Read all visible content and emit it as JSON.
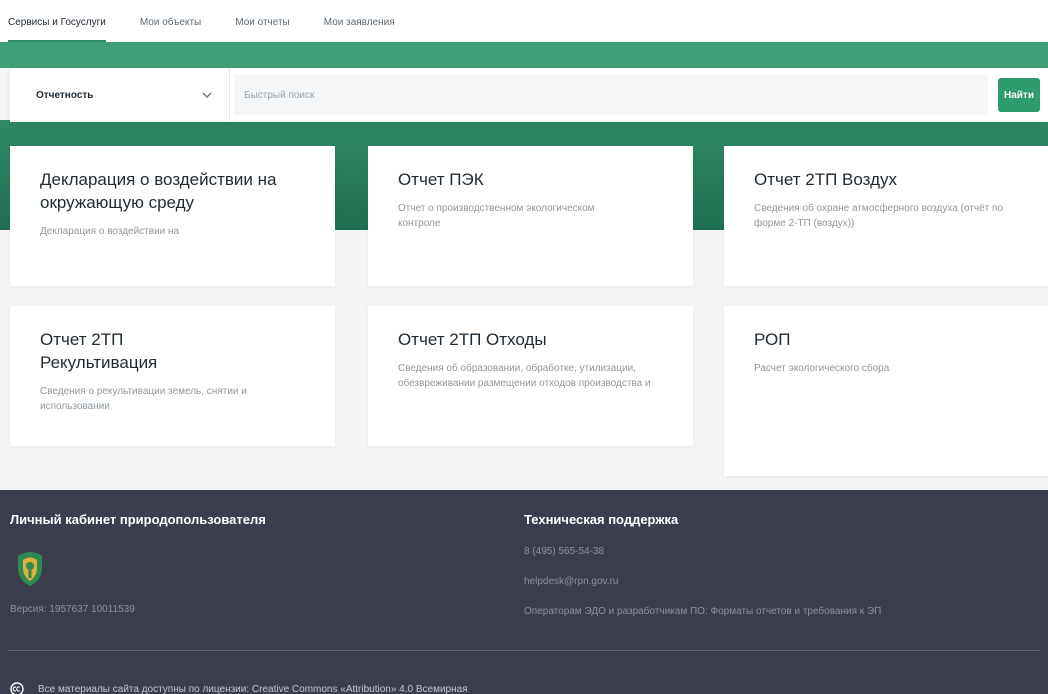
{
  "tabs": [
    {
      "label": "Сервисы и Госуслуги"
    },
    {
      "label": "Мои объекты"
    },
    {
      "label": "Мои отчеты"
    },
    {
      "label": "Мои заявления"
    }
  ],
  "search": {
    "category_value": "Отчетность",
    "placeholder": "Быстрый поиск",
    "button_label": "Найти"
  },
  "cards": [
    {
      "title": "Декларация о воздействии на окружающую среду",
      "description": "Декларация о воздействии на"
    },
    {
      "title": "Отчет ПЭК",
      "description": "Отчет о производственном экологическом контроле"
    },
    {
      "title": "Отчет 2ТП Воздух",
      "description": "Сведения об охране атмосферного воздуха (отчёт по форме 2-ТП (воздух))"
    },
    {
      "title": "Отчет 2ТП Рекультивация",
      "description": "Сведения о рекультивации земель, снятии и использовании"
    },
    {
      "title": "Отчет 2ТП Отходы",
      "description": "Сведения об образовании, обработке, утилизации, обезвреживании размещении отходов производства и"
    },
    {
      "title": "РОП",
      "description": "Расчет экологического сбора"
    }
  ],
  "footer": {
    "cabinet_title": "Личный кабинет природопользователя",
    "version": "Версия: 1957637 10011539",
    "support_title": "Техническая поддержка",
    "phone": "8 (495) 565-54-38",
    "email": "helpdesk@rpn.gov.ru",
    "operators_link": "Операторам ЭДО и разработчикам ПО: Форматы отчетов и требования к ЭП",
    "license": "Все материалы сайта доступны по лицензии: Creative Commons «Attribution» 4.0 Всемирная"
  },
  "colors": {
    "accent": "#2e9b6e",
    "band": "#3f9f78",
    "footer": "#3b3f4d"
  }
}
